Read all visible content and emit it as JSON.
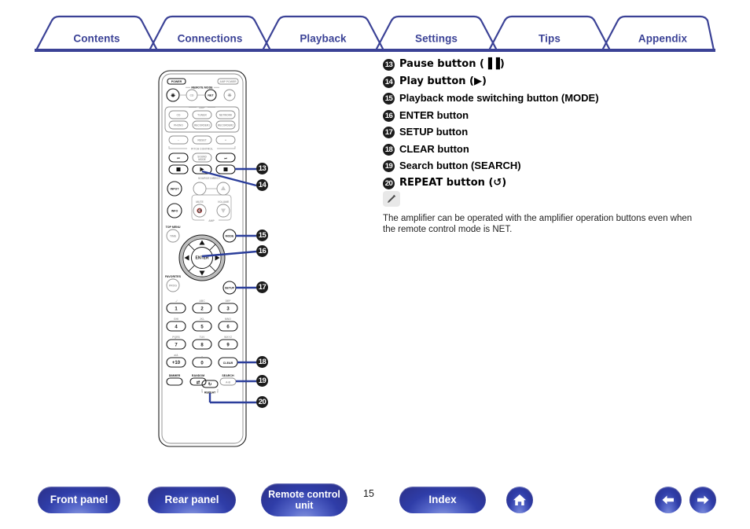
{
  "tabs": [
    {
      "label": "Contents",
      "name": "tab-contents"
    },
    {
      "label": "Connections",
      "name": "tab-connections"
    },
    {
      "label": "Playback",
      "name": "tab-playback"
    },
    {
      "label": "Settings",
      "name": "tab-settings"
    },
    {
      "label": "Tips",
      "name": "tab-tips"
    },
    {
      "label": "Appendix",
      "name": "tab-appendix"
    }
  ],
  "tab_color": "#3b4296",
  "descriptions": [
    {
      "num": "13",
      "text": "Pause button (▐▐)"
    },
    {
      "num": "14",
      "text": "Play button (▶)"
    },
    {
      "num": "15",
      "text": "Playback mode switching button (MODE)"
    },
    {
      "num": "16",
      "text": "ENTER button"
    },
    {
      "num": "17",
      "text": "SETUP button"
    },
    {
      "num": "18",
      "text": "CLEAR button"
    },
    {
      "num": "19",
      "text": "Search button (SEARCH)"
    },
    {
      "num": "20",
      "text": "REPEAT button (↺)"
    }
  ],
  "note": {
    "icon": "pencil-icon",
    "text": "The amplifier can be operated with the amplifier operation buttons even when the remote control mode is NET."
  },
  "callouts": [
    {
      "num": "13"
    },
    {
      "num": "14"
    },
    {
      "num": "15"
    },
    {
      "num": "16"
    },
    {
      "num": "17"
    },
    {
      "num": "18"
    },
    {
      "num": "19"
    },
    {
      "num": "20"
    }
  ],
  "remote": {
    "title": "Remote control unit",
    "labels": {
      "power": "POWER",
      "amp_power": "AMP POWER",
      "remote_mode": "REMOTE MODE",
      "mode_cd": "CD",
      "mode_net": "NET",
      "amp_group": "AMP",
      "src_cd": "CD",
      "src_tuner": "TUNER",
      "src_network": "NETWORK",
      "src_phono": "PHONO",
      "src_recorder1": "RECORDER1",
      "src_recorder2": "RECORDER2",
      "pitch_minus": "–",
      "pitch_reset": "RESET",
      "pitch_plus": "+",
      "pitch_control": "PITCH CONTROL",
      "skip_prev": "⏮",
      "sound_mode": "SOUND MODE",
      "skip_next": "⏭",
      "stop_left": "■",
      "play": "▶",
      "stop_right": "■",
      "source_direct": "SOURCE DIRECT",
      "input": "INPUT",
      "info": "INFO",
      "mute": "MUTE",
      "volume": "VOLUME",
      "amp_bracket": "AMP",
      "top_menu": "TOP MENU",
      "time": "TIME",
      "mode": "MODE",
      "enter": "ENTER",
      "favorites": "FAVORITES",
      "prog": "PROG",
      "setup": "SETUP",
      "clear": "CLEAR",
      "dimmer": "DIMMER",
      "random": "RANDOM",
      "repeat": "REPEAT",
      "search": "SEARCH",
      "search_ab": "A-B"
    },
    "keypad": [
      {
        "key": "1",
        "sub": ".,/"
      },
      {
        "key": "2",
        "sub": "ABC"
      },
      {
        "key": "3",
        "sub": "DEF"
      },
      {
        "key": "4",
        "sub": "GHI"
      },
      {
        "key": "5",
        "sub": "JKL"
      },
      {
        "key": "6",
        "sub": "MNO"
      },
      {
        "key": "7",
        "sub": "PQRS"
      },
      {
        "key": "8",
        "sub": "TUV"
      },
      {
        "key": "9",
        "sub": "WXYZ"
      },
      {
        "key": "+10",
        "sub": "a/A"
      },
      {
        "key": "0",
        "sub": "␣"
      },
      {
        "key": "CLEAR",
        "sub": ""
      }
    ]
  },
  "bottom": {
    "front_panel": "Front panel",
    "rear_panel": "Rear panel",
    "remote_control_unit": "Remote control\nunit",
    "remote_control_unit_line1": "Remote control",
    "remote_control_unit_line2": "unit",
    "page_number": "15",
    "index": "Index",
    "home_icon": "home-icon",
    "prev_icon": "arrow-left-icon",
    "next_icon": "arrow-right-icon"
  }
}
